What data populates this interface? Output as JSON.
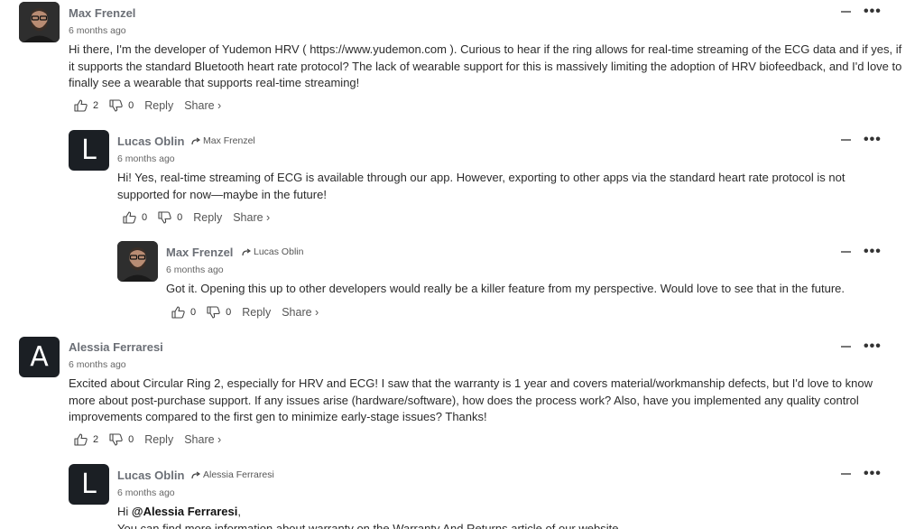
{
  "comments": [
    {
      "author": "Max Frenzel",
      "time": "6 months ago",
      "text": "Hi there, I'm the developer of Yudemon HRV ( https://www.yudemon.com ). Curious to hear if the ring allows for real-time streaming of the ECG data and if yes, if it supports the standard Bluetooth heart rate protocol? The lack of wearable support for this is massively limiting the adoption of HRV biofeedback, and I'd love to finally see a wearable that supports real-time streaming!",
      "likes": "2",
      "dislikes": "0",
      "reply_label": "Reply",
      "share_label": "Share ›"
    },
    {
      "author": "Lucas Oblin",
      "avatar_letter": "L",
      "reply_to": "Max Frenzel",
      "time": "6 months ago",
      "text": "Hi! Yes, real-time streaming of ECG is available through our app. However, exporting to other apps via the standard heart rate protocol is not supported for now—maybe in the future!",
      "likes": "0",
      "dislikes": "0",
      "reply_label": "Reply",
      "share_label": "Share ›"
    },
    {
      "author": "Max Frenzel",
      "reply_to": "Lucas Oblin",
      "time": "6 months ago",
      "text": "Got it. Opening this up to other developers would really be a killer feature from my perspective. Would love to see that in the future.",
      "likes": "0",
      "dislikes": "0",
      "reply_label": "Reply",
      "share_label": "Share ›"
    },
    {
      "author": "Alessia Ferraresi",
      "avatar_letter": "A",
      "time": "6 months ago",
      "text": "Excited about Circular Ring 2, especially for HRV and ECG! I saw that the warranty is 1 year and covers material/workmanship defects, but I'd love to know more about post-purchase support. If any issues arise (hardware/software), how does the process work? Also, have you implemented any quality control improvements compared to the first gen to minimize early-stage issues? Thanks!",
      "likes": "2",
      "dislikes": "0",
      "reply_label": "Reply",
      "share_label": "Share ›"
    },
    {
      "author": "Lucas Oblin",
      "avatar_letter": "L",
      "reply_to": "Alessia Ferraresi",
      "time": "6 months ago",
      "text_prefix": "Hi ",
      "mention": "@Alessia Ferraresi",
      "text_suffix": ",",
      "text_line2": "You can find more information about warranty on the Warranty And Returns article of our website"
    }
  ],
  "icons": {
    "like": "thumbs-up-icon",
    "dislike": "thumbs-down-icon",
    "collapse": "minus-icon",
    "more": "more-dots-icon",
    "reply_to": "reply-arrow-icon"
  },
  "controls": {
    "more_glyph": "•••"
  }
}
